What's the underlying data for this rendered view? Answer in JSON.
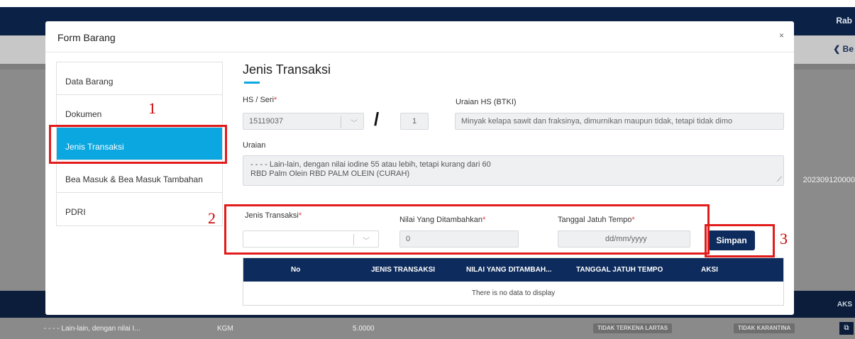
{
  "background": {
    "topbar_text": "Rab",
    "back_text": "❮ Be",
    "reference_text": "202309120000",
    "table_header_action": "AKS",
    "row": {
      "uraian": "- - - - Lain-lain, dengan nilai I...",
      "satuan": "KGM",
      "jumlah": "5.0000",
      "lartas_badge": "TIDAK TERKENA LARTAS",
      "karantina_badge": "TIDAK KARANTINA"
    }
  },
  "modal": {
    "title": "Form Barang",
    "close": "×"
  },
  "sidebar": {
    "items": [
      {
        "label": "Data Barang",
        "active": false
      },
      {
        "label": "Dokumen",
        "active": false
      },
      {
        "label": "Jenis Transaksi",
        "active": true
      },
      {
        "label": "Bea Masuk & Bea Masuk Tambahan",
        "active": false
      },
      {
        "label": "PDRI",
        "active": false
      }
    ]
  },
  "section": {
    "title": "Jenis Transaksi"
  },
  "hs": {
    "label": "HS / Seri",
    "value": "15119037",
    "separator": "/",
    "seri_value": "1",
    "uraian_hs_label": "Uraian HS (BTKI)",
    "uraian_hs_value": "Minyak kelapa sawit dan fraksinya, dimurnikan maupun tidak, tetapi tidak dimo"
  },
  "uraian": {
    "label": "Uraian",
    "line1": "- - - - Lain-lain, dengan nilai iodine 55 atau lebih, tetapi kurang dari 60",
    "line2": "RBD Palm Olein RBD PALM OLEIN (CURAH)"
  },
  "form": {
    "jenis_transaksi_label": "Jenis Transaksi",
    "jenis_transaksi_value": "",
    "nilai_label": "Nilai Yang Ditambahkan",
    "nilai_value": "0",
    "tanggal_label": "Tanggal Jatuh Tempo",
    "tanggal_placeholder": "dd/mm/yyyy",
    "required_mark": "*",
    "save_label": "Simpan"
  },
  "table": {
    "headers": [
      "No",
      "JENIS TRANSAKSI",
      "NILAI YANG DITAMBAH...",
      "TANGGAL JATUH TEMPO",
      "AKSI"
    ],
    "empty_text": "There is no data to display"
  },
  "annotations": {
    "n1": "1",
    "n2": "2",
    "n3": "3"
  },
  "colors": {
    "accent": "#0aa7e0",
    "primary": "#0d2b5c",
    "annotation_red": "#e21b1b"
  }
}
